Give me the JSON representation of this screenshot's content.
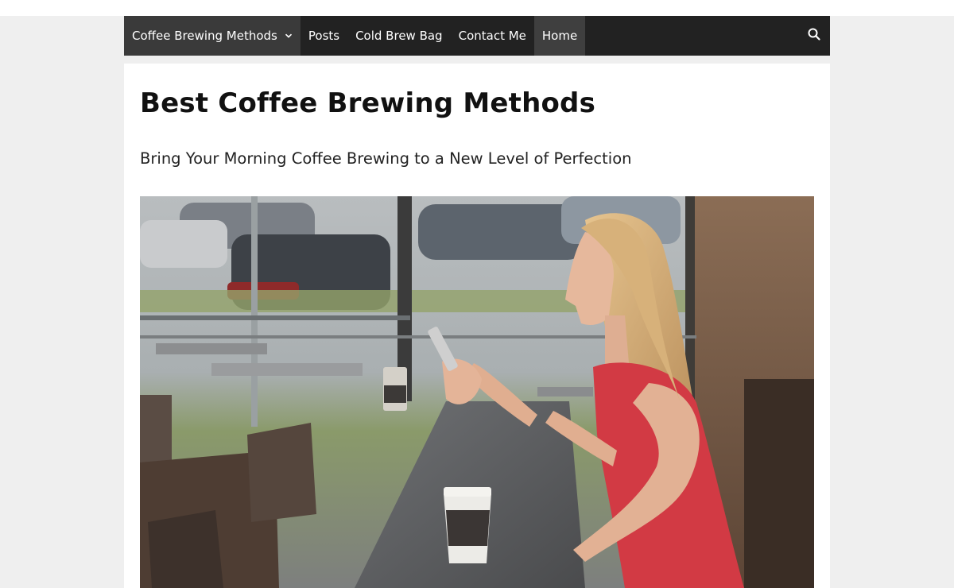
{
  "nav": {
    "items": [
      {
        "label": "Coffee Brewing Methods",
        "has_dropdown": true
      },
      {
        "label": "Posts"
      },
      {
        "label": "Cold Brew Bag"
      },
      {
        "label": "Contact Me"
      },
      {
        "label": "Home",
        "active": true
      }
    ],
    "search_icon": "search-icon",
    "dropdown_icon": "chevron-down-icon"
  },
  "page": {
    "title": "Best Coffee Brewing Methods",
    "subtitle": "Bring Your Morning Coffee Brewing to a New Level of Perfection"
  },
  "colors": {
    "nav_bg": "#222222",
    "nav_active_bg": "#3f3f3f",
    "page_bg": "#efefef",
    "content_bg": "#ffffff"
  }
}
